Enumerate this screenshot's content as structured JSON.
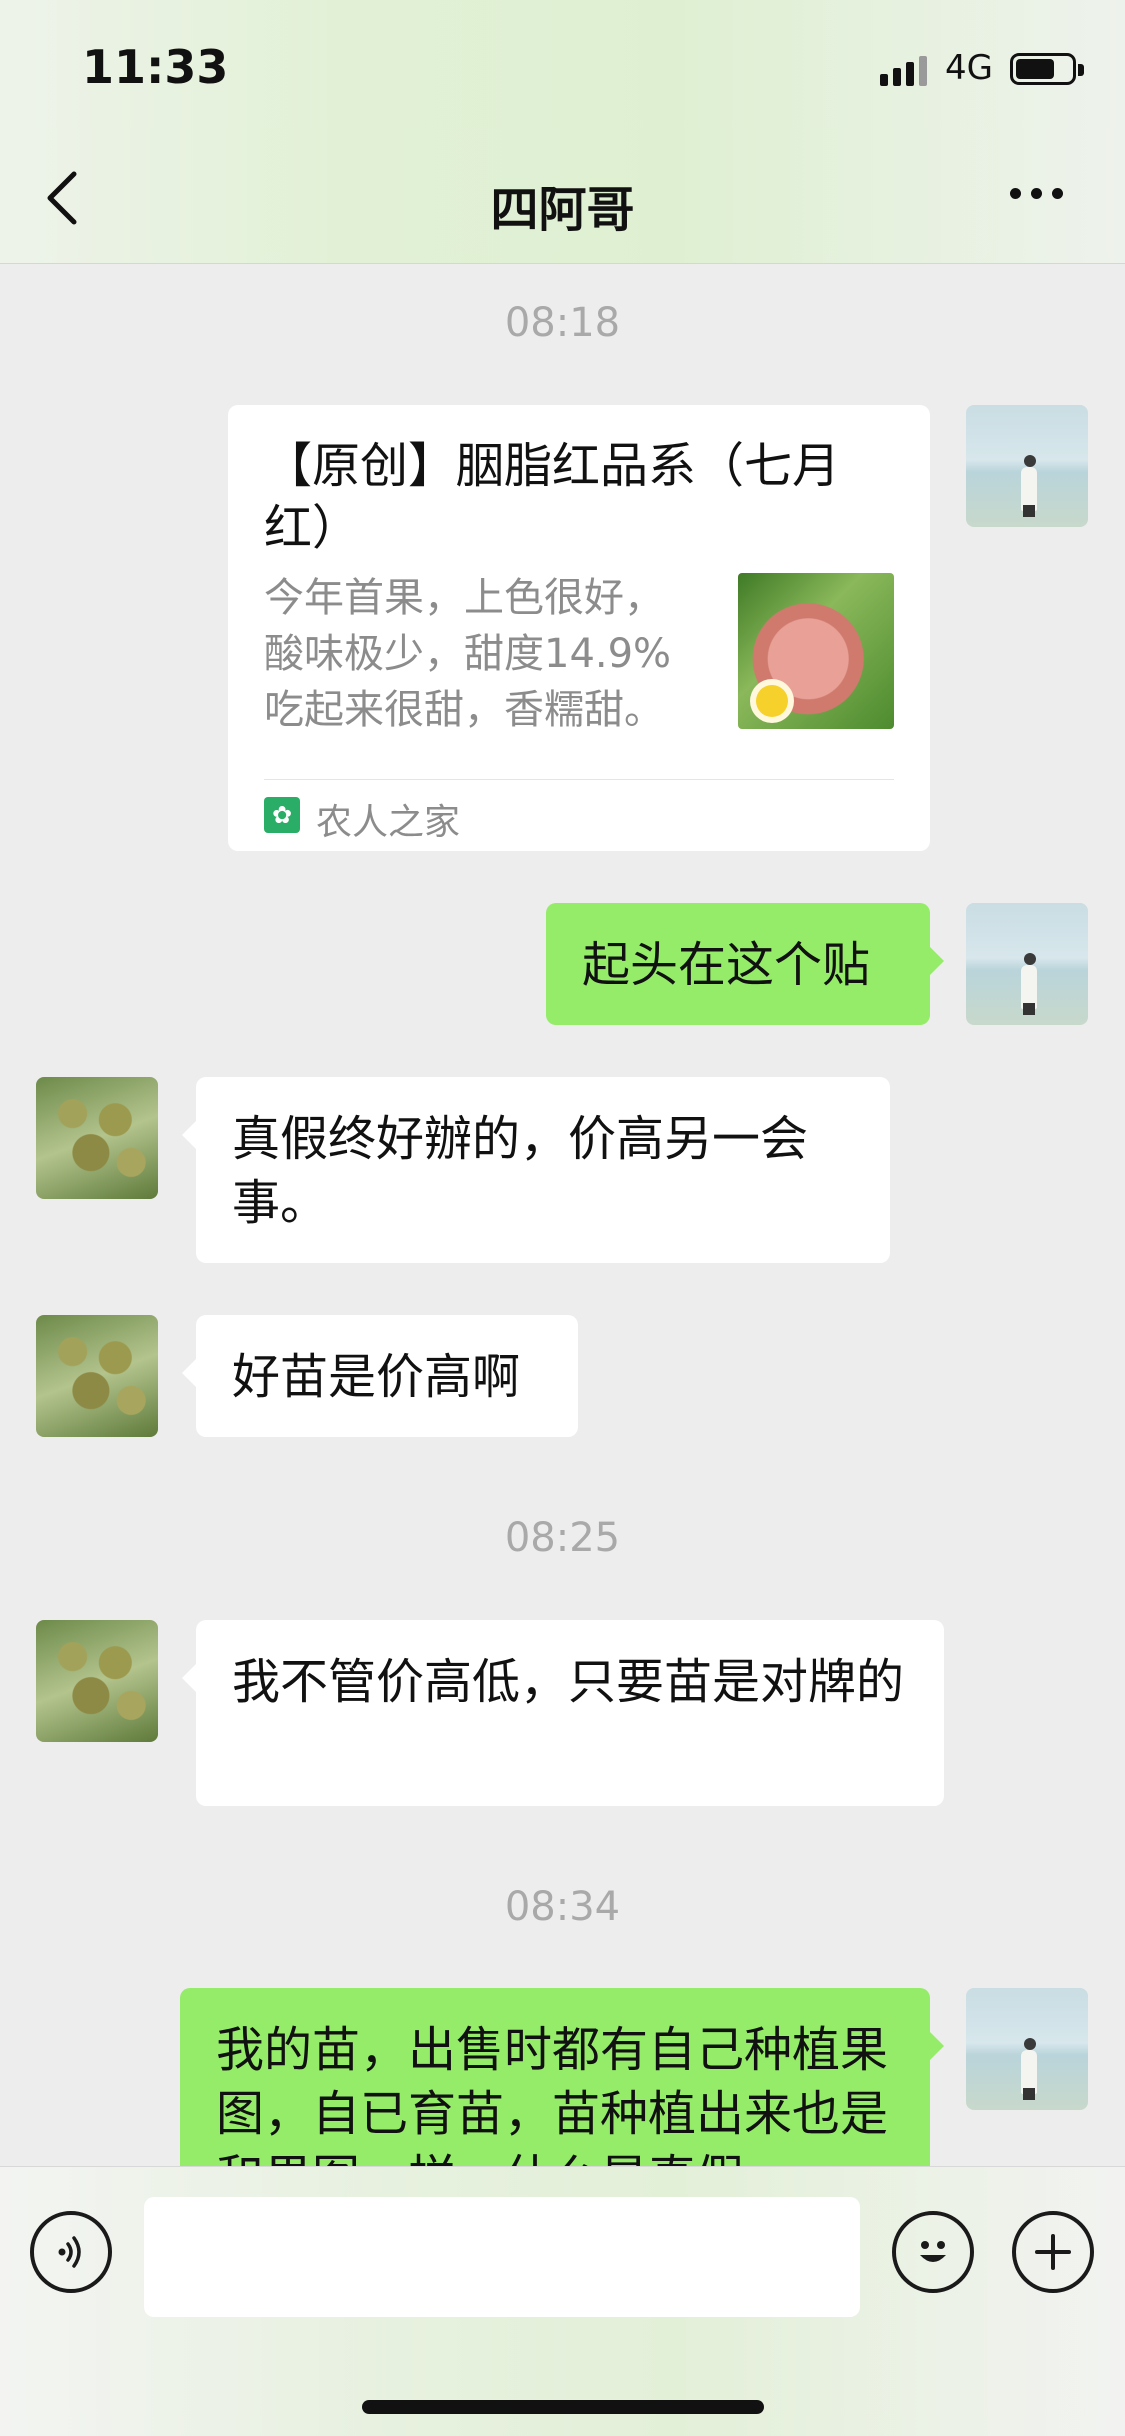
{
  "status_bar": {
    "time": "11:33",
    "network": "4G"
  },
  "header": {
    "title": "四阿哥",
    "back_icon": "chevron-left-icon",
    "more_icon": "more-horizontal-icon"
  },
  "messages": {
    "time1": "08:18",
    "card": {
      "title": "【原创】胭脂红品系（七月红）",
      "description": "今年首果，上色很好，酸味极少，甜度14.9%吃起来很甜，香糯甜。",
      "source": "农人之家"
    },
    "m1": "起头在这个贴",
    "m2": "真假终好辦的，价高另一会事。",
    "m3": "好苗是价高啊",
    "time2": "08:25",
    "m4": "我不管价高低，只要苗是对牌的",
    "time3": "08:34",
    "m5": "我的苗，出售时都有自己种植果图，自已育苗，苗种植出来也是和果图一样，什么是真假"
  },
  "input_bar": {
    "voice_icon": "voice-icon",
    "emoji_icon": "emoji-icon",
    "plus_icon": "plus-icon",
    "input_value": ""
  }
}
